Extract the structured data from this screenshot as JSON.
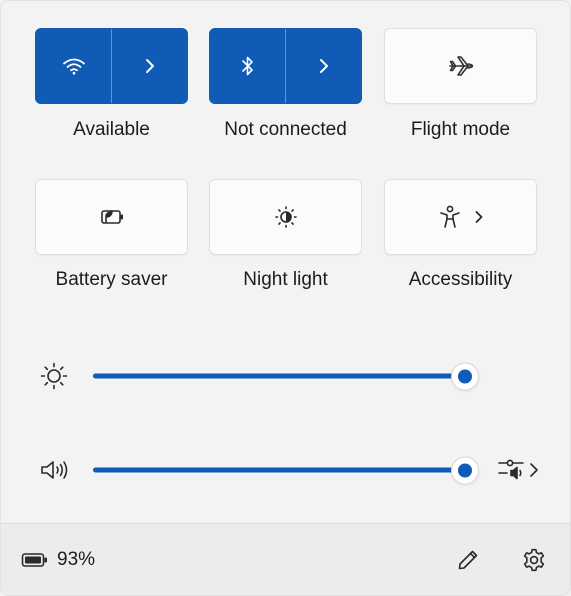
{
  "tiles": {
    "wifi": {
      "label": "Available",
      "state": "on",
      "icon": "wifi-icon"
    },
    "bluetooth": {
      "label": "Not connected",
      "state": "on",
      "icon": "bluetooth-icon"
    },
    "flight": {
      "label": "Flight mode",
      "state": "off",
      "icon": "airplane-icon"
    },
    "battery_saver": {
      "label": "Battery saver",
      "state": "off",
      "icon": "battery-saver-icon"
    },
    "night_light": {
      "label": "Night light",
      "state": "off",
      "icon": "night-light-icon"
    },
    "accessibility": {
      "label": "Accessibility",
      "state": "off",
      "icon": "accessibility-icon"
    }
  },
  "sliders": {
    "brightness": {
      "icon": "brightness-icon",
      "level": 1.0
    },
    "volume": {
      "icon": "volume-icon",
      "level": 1.0
    }
  },
  "footer": {
    "battery_percent": "93%",
    "icons": [
      "battery-icon",
      "edit-pencil-icon",
      "settings-gear-icon"
    ]
  },
  "colors": {
    "accent": "#0f5bb5",
    "tile_off": "#fbfbfb",
    "background": "#f3f3f3"
  }
}
